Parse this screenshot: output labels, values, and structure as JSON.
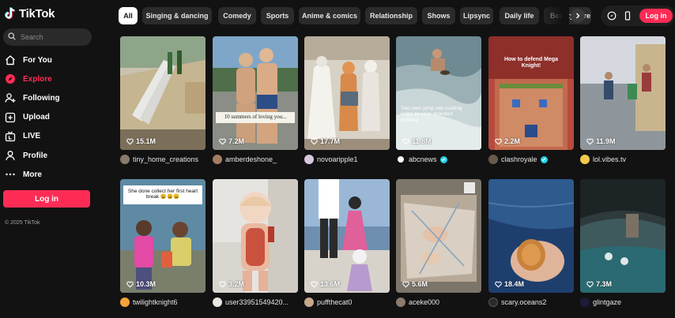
{
  "app": {
    "name": "TikTok"
  },
  "search": {
    "placeholder": "Search"
  },
  "nav": [
    {
      "label": "For You",
      "icon": "home-icon",
      "active": false
    },
    {
      "label": "Explore",
      "icon": "compass-icon",
      "active": true
    },
    {
      "label": "Following",
      "icon": "person-plus-icon",
      "active": false
    },
    {
      "label": "Upload",
      "icon": "plus-square-icon",
      "active": false
    },
    {
      "label": "LIVE",
      "icon": "live-tv-icon",
      "active": false
    },
    {
      "label": "Profile",
      "icon": "person-icon",
      "active": false
    },
    {
      "label": "More",
      "icon": "more-dots-icon",
      "active": false
    }
  ],
  "sidebar": {
    "login_label": "Log in",
    "copyright": "© 2025 TikTok"
  },
  "categories": [
    "All",
    "Singing & dancing",
    "Comedy",
    "Sports",
    "Anime & comics",
    "Relationship",
    "Shows",
    "Lipsync",
    "Daily life",
    "Beauty care"
  ],
  "top_right": {
    "login_label": "Log in",
    "icons": [
      "coin-icon",
      "device-icon"
    ]
  },
  "accent": "#fe2c55",
  "videos": [
    {
      "views": "15.1M",
      "author": "tiny_home_creations",
      "verified": false,
      "caption": ""
    },
    {
      "views": "7.2M",
      "author": "amberdeshone_",
      "verified": false,
      "caption": "10 summers of loving you..."
    },
    {
      "views": "17.7M",
      "author": "novoaripple1",
      "verified": false,
      "caption": ""
    },
    {
      "views": "11.8M",
      "author": "abcnews",
      "verified": true,
      "caption": "Two men jump into rushing water to save stranded monkey"
    },
    {
      "views": "2.2M",
      "author": "clashroyale",
      "verified": true,
      "caption": "How to defend Mega Knight!"
    },
    {
      "views": "11.9M",
      "author": "lol.vibes.tv",
      "verified": false,
      "caption": ""
    },
    {
      "views": "10.3M",
      "author": "twilightknight6",
      "verified": false,
      "caption": "She done collect her first heart break 😩😩😩"
    },
    {
      "views": "3.2M",
      "author": "user33951549420...",
      "verified": false,
      "caption": ""
    },
    {
      "views": "13.6M",
      "author": "puffthecat0",
      "verified": false,
      "caption": ""
    },
    {
      "views": "5.6M",
      "author": "aceke000",
      "verified": false,
      "caption": ""
    },
    {
      "views": "18.4M",
      "author": "scary.oceans2",
      "verified": false,
      "caption": ""
    },
    {
      "views": "7.3M",
      "author": "glintgaze",
      "verified": false,
      "caption": ""
    }
  ]
}
